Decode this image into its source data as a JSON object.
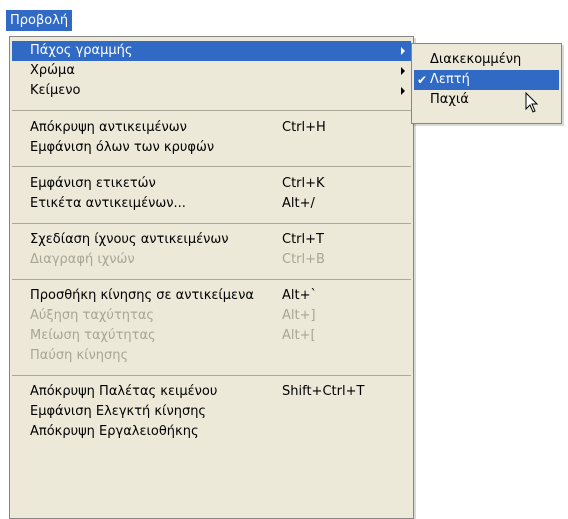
{
  "menubar": {
    "title": "Προβολή"
  },
  "menu": {
    "items": [
      {
        "label": "Πάχος γραμμής",
        "shortcut": "",
        "submenu": true,
        "highlighted": true,
        "disabled": false
      },
      {
        "label": "Χρώμα",
        "shortcut": "",
        "submenu": true,
        "highlighted": false,
        "disabled": false
      },
      {
        "label": "Κείμενο",
        "shortcut": "",
        "submenu": true,
        "highlighted": false,
        "disabled": false
      },
      {
        "label": "Απόκρυψη αντικειμένων",
        "shortcut": "Ctrl+H",
        "submenu": false,
        "highlighted": false,
        "disabled": false
      },
      {
        "label": "Εμφάνιση όλων των κρυφών",
        "shortcut": "",
        "submenu": false,
        "highlighted": false,
        "disabled": false
      },
      {
        "label": "Εμφάνιση ετικετών",
        "shortcut": "Ctrl+K",
        "submenu": false,
        "highlighted": false,
        "disabled": false
      },
      {
        "label": "Ετικέτα αντικειμένων...",
        "shortcut": "Alt+/",
        "submenu": false,
        "highlighted": false,
        "disabled": false
      },
      {
        "label": "Σχεδίαση ίχνους αντικειμένων",
        "shortcut": "Ctrl+T",
        "submenu": false,
        "highlighted": false,
        "disabled": false
      },
      {
        "label": "Διαγραφή ιχνών",
        "shortcut": "Ctrl+B",
        "submenu": false,
        "highlighted": false,
        "disabled": true
      },
      {
        "label": "Προσθήκη κίνησης σε αντικείμενα",
        "shortcut": "Alt+`",
        "submenu": false,
        "highlighted": false,
        "disabled": false
      },
      {
        "label": "Αύξηση ταχύτητας",
        "shortcut": "Alt+]",
        "submenu": false,
        "highlighted": false,
        "disabled": true
      },
      {
        "label": "Μείωση ταχύτητας",
        "shortcut": "Alt+[",
        "submenu": false,
        "highlighted": false,
        "disabled": true
      },
      {
        "label": "Παύση κίνησης",
        "shortcut": "",
        "submenu": false,
        "highlighted": false,
        "disabled": true
      },
      {
        "label": "Απόκρυψη Παλέτας κειμένου",
        "shortcut": "Shift+Ctrl+T",
        "submenu": false,
        "highlighted": false,
        "disabled": false
      },
      {
        "label": "Εμφάνιση Ελεγκτή κίνησης",
        "shortcut": "",
        "submenu": false,
        "highlighted": false,
        "disabled": false
      },
      {
        "label": "Απόκρυψη Εργαλειοθήκης",
        "shortcut": "",
        "submenu": false,
        "highlighted": false,
        "disabled": false
      }
    ]
  },
  "submenu": {
    "items": [
      {
        "label": "Διακεκομμένη",
        "checked": false,
        "highlighted": false
      },
      {
        "label": "Λεπτή",
        "checked": true,
        "highlighted": true
      },
      {
        "label": "Παχιά",
        "checked": false,
        "highlighted": false
      }
    ]
  },
  "colors": {
    "highlight": "#316ac5",
    "menu_bg": "#ece9d8",
    "disabled_text": "#a7a695"
  }
}
